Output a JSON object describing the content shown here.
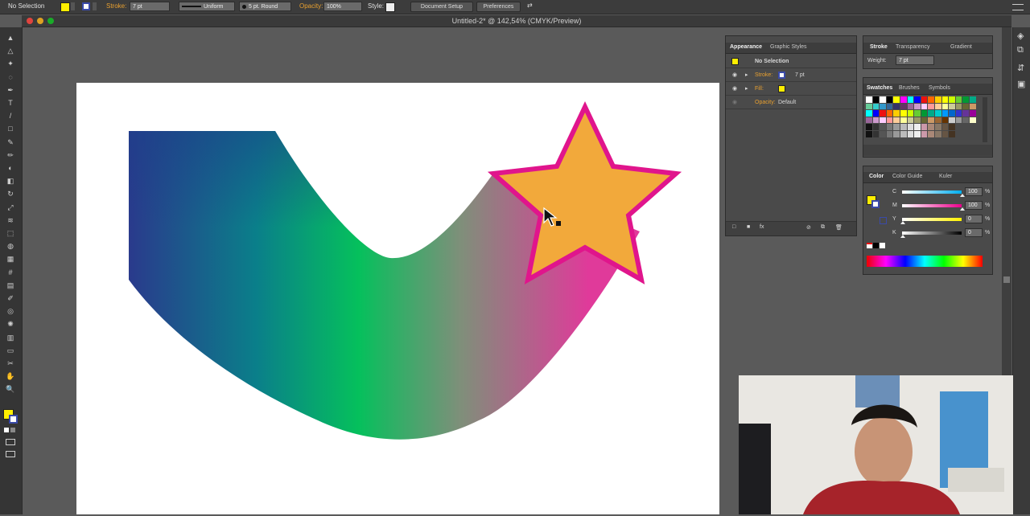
{
  "control_bar": {
    "selection": "No Selection",
    "stroke_label": "Stroke:",
    "stroke_weight": "7 pt",
    "profile": "Uniform",
    "brush": "5 pt. Round",
    "opacity_label": "Opacity:",
    "opacity_value": "100%",
    "style_label": "Style:",
    "document_setup": "Document Setup",
    "preferences": "Preferences",
    "fill_color": "#ffee00",
    "stroke_color": "#3a4aa8"
  },
  "window": {
    "title": "Untitled-2* @ 142,54% (CMYK/Preview)"
  },
  "appearance_panel": {
    "tabs": [
      "Appearance",
      "Graphic Styles"
    ],
    "selection": "No Selection",
    "stroke_label": "Stroke:",
    "stroke_value": "7 pt",
    "fill_label": "Fill:",
    "opacity_label": "Opacity:",
    "opacity_value": "Default"
  },
  "stroke_panel": {
    "tabs": [
      "Stroke",
      "Transparency",
      "Gradient"
    ],
    "weight_label": "Weight:",
    "weight_value": "7 pt"
  },
  "swatches_panel": {
    "tabs": [
      "Swatches",
      "Brushes",
      "Symbols"
    ]
  },
  "color_panel": {
    "tabs": [
      "Color",
      "Color Guide",
      "Kuler"
    ],
    "channels": [
      {
        "label": "C",
        "value": "100",
        "unit": "%",
        "color": "#00aeef"
      },
      {
        "label": "M",
        "value": "100",
        "unit": "%",
        "color": "#ec008c"
      },
      {
        "label": "Y",
        "value": "0",
        "unit": "%",
        "color": "#fff200"
      },
      {
        "label": "K",
        "value": "0",
        "unit": "%",
        "color": "#000000"
      }
    ]
  },
  "artwork": {
    "star_fill": "#f2a93b",
    "star_stroke": "#e0158c",
    "ribbon_colors": [
      "#2a3a8c",
      "#0a7f8a",
      "#05c05c",
      "#7f8f7a",
      "#e03a9a"
    ]
  },
  "icons": {
    "tools": [
      "selection-icon",
      "direct-selection-icon",
      "magic-wand-icon",
      "lasso-icon",
      "pen-icon",
      "type-icon",
      "line-icon",
      "rectangle-icon",
      "paintbrush-icon",
      "pencil-icon",
      "blob-brush-icon",
      "eraser-icon",
      "rotate-icon",
      "scale-icon",
      "width-icon",
      "free-transform-icon",
      "shape-builder-icon",
      "perspective-grid-icon",
      "mesh-icon",
      "gradient-icon",
      "eyedropper-icon",
      "blend-icon",
      "symbol-sprayer-icon",
      "column-graph-icon",
      "artboard-icon",
      "slice-icon",
      "hand-icon",
      "zoom-icon"
    ]
  }
}
